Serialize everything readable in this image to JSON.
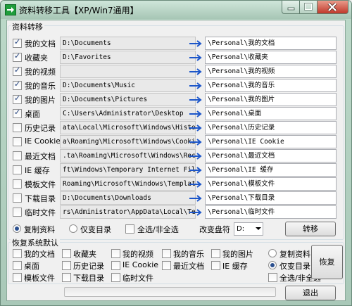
{
  "window": {
    "title": "资料转移工具【XP/Win7通用】"
  },
  "transfer": {
    "group_title": "资料转移",
    "items": [
      {
        "label": "我的文档",
        "checked": true,
        "source": "D:\\Documents",
        "dest": "\\Personal\\我的文档"
      },
      {
        "label": "收藏夹",
        "checked": true,
        "source": "D:\\Favorites",
        "dest": "\\Personal\\收藏夹"
      },
      {
        "label": "我的视频",
        "checked": true,
        "source": "",
        "dest": "\\Personal\\我的视频"
      },
      {
        "label": "我的音乐",
        "checked": true,
        "source": "D:\\Documents\\Music",
        "dest": "\\Personal\\我的音乐"
      },
      {
        "label": "我的图片",
        "checked": true,
        "source": "D:\\Documents\\Pictures",
        "dest": "\\Personal\\我的图片"
      },
      {
        "label": "桌面",
        "checked": true,
        "source": "C:\\Users\\Administrator\\Desktop",
        "dest": "\\Personal\\桌面"
      },
      {
        "label": "历史记录",
        "checked": false,
        "source": "ata\\Local\\Microsoft\\Windows\\History",
        "dest": "\\Personal\\历史记录"
      },
      {
        "label": "IE Cookie",
        "checked": false,
        "source": "a\\Roaming\\Microsoft\\Windows\\Cookies",
        "dest": "\\Personal\\IE Cookie"
      },
      {
        "label": "最近文档",
        "checked": false,
        "source": ".ta\\Roaming\\Microsoft\\Windows\\Recent",
        "dest": "\\Personal\\最近文档"
      },
      {
        "label": "IE 缓存",
        "checked": false,
        "source": "ft\\Windows\\Temporary Internet Files",
        "dest": "\\Personal\\IE 缓存"
      },
      {
        "label": "模板文件",
        "checked": false,
        "source": "Roaming\\Microsoft\\Windows\\Templates",
        "dest": "\\Personal\\模板文件"
      },
      {
        "label": "下载目录",
        "checked": false,
        "source": "D:\\Documents\\Downloads",
        "dest": "\\Personal\\下载目录"
      },
      {
        "label": "临时文件",
        "checked": false,
        "source": "rs\\Administrator\\AppData\\Local\\Temp",
        "dest": "\\Personal\\临时文件"
      }
    ],
    "mode_copy_label": "复制资料",
    "mode_copy_selected": true,
    "mode_dironly_label": "仅变目录",
    "select_all_label": "全选/非全选",
    "drive_label": "改变盘符",
    "drive_value": "D:",
    "transfer_button": "转移"
  },
  "restore": {
    "group_title": "恢复系统默认",
    "items": [
      {
        "label": "我的文档",
        "checked": false
      },
      {
        "label": "收藏夹",
        "checked": false
      },
      {
        "label": "我的视频",
        "checked": false
      },
      {
        "label": "我的音乐",
        "checked": false
      },
      {
        "label": "我的图片",
        "checked": false
      },
      {
        "label": "桌面",
        "checked": false
      },
      {
        "label": "历史记录",
        "checked": false
      },
      {
        "label": "IE Cookie",
        "checked": false
      },
      {
        "label": "最近文档",
        "checked": false
      },
      {
        "label": "IE 缓存",
        "checked": false
      },
      {
        "label": "模板文件",
        "checked": false
      },
      {
        "label": "下载目录",
        "checked": false
      },
      {
        "label": "临时文件",
        "checked": false
      }
    ],
    "mode_copy_label": "复制资料",
    "mode_dironly_label": "仅变目录",
    "mode_dironly_selected": true,
    "select_all_label": "全选/非全选",
    "restore_button": "恢复"
  },
  "footer": {
    "progress": 0,
    "exit_button": "退出"
  },
  "icons": {
    "app": "green-arrow-icon",
    "transfer_arrow": "right-arrow-icon"
  },
  "colors": {
    "titlebar": "#bcd9c9",
    "arrow": "#1c56c9",
    "close_button": "#c0392b"
  }
}
